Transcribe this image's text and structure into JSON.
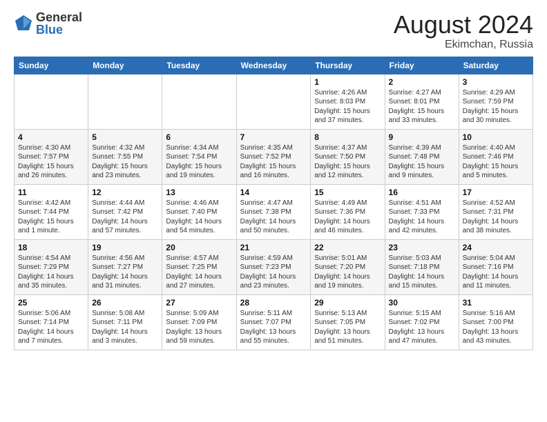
{
  "header": {
    "logo_general": "General",
    "logo_blue": "Blue",
    "month_title": "August 2024",
    "location": "Ekimchan, Russia"
  },
  "calendar": {
    "headers": [
      "Sunday",
      "Monday",
      "Tuesday",
      "Wednesday",
      "Thursday",
      "Friday",
      "Saturday"
    ],
    "weeks": [
      [
        {
          "day": "",
          "detail": ""
        },
        {
          "day": "",
          "detail": ""
        },
        {
          "day": "",
          "detail": ""
        },
        {
          "day": "",
          "detail": ""
        },
        {
          "day": "1",
          "detail": "Sunrise: 4:26 AM\nSunset: 8:03 PM\nDaylight: 15 hours\nand 37 minutes."
        },
        {
          "day": "2",
          "detail": "Sunrise: 4:27 AM\nSunset: 8:01 PM\nDaylight: 15 hours\nand 33 minutes."
        },
        {
          "day": "3",
          "detail": "Sunrise: 4:29 AM\nSunset: 7:59 PM\nDaylight: 15 hours\nand 30 minutes."
        }
      ],
      [
        {
          "day": "4",
          "detail": "Sunrise: 4:30 AM\nSunset: 7:57 PM\nDaylight: 15 hours\nand 26 minutes."
        },
        {
          "day": "5",
          "detail": "Sunrise: 4:32 AM\nSunset: 7:55 PM\nDaylight: 15 hours\nand 23 minutes."
        },
        {
          "day": "6",
          "detail": "Sunrise: 4:34 AM\nSunset: 7:54 PM\nDaylight: 15 hours\nand 19 minutes."
        },
        {
          "day": "7",
          "detail": "Sunrise: 4:35 AM\nSunset: 7:52 PM\nDaylight: 15 hours\nand 16 minutes."
        },
        {
          "day": "8",
          "detail": "Sunrise: 4:37 AM\nSunset: 7:50 PM\nDaylight: 15 hours\nand 12 minutes."
        },
        {
          "day": "9",
          "detail": "Sunrise: 4:39 AM\nSunset: 7:48 PM\nDaylight: 15 hours\nand 9 minutes."
        },
        {
          "day": "10",
          "detail": "Sunrise: 4:40 AM\nSunset: 7:46 PM\nDaylight: 15 hours\nand 5 minutes."
        }
      ],
      [
        {
          "day": "11",
          "detail": "Sunrise: 4:42 AM\nSunset: 7:44 PM\nDaylight: 15 hours\nand 1 minute."
        },
        {
          "day": "12",
          "detail": "Sunrise: 4:44 AM\nSunset: 7:42 PM\nDaylight: 14 hours\nand 57 minutes."
        },
        {
          "day": "13",
          "detail": "Sunrise: 4:46 AM\nSunset: 7:40 PM\nDaylight: 14 hours\nand 54 minutes."
        },
        {
          "day": "14",
          "detail": "Sunrise: 4:47 AM\nSunset: 7:38 PM\nDaylight: 14 hours\nand 50 minutes."
        },
        {
          "day": "15",
          "detail": "Sunrise: 4:49 AM\nSunset: 7:36 PM\nDaylight: 14 hours\nand 46 minutes."
        },
        {
          "day": "16",
          "detail": "Sunrise: 4:51 AM\nSunset: 7:33 PM\nDaylight: 14 hours\nand 42 minutes."
        },
        {
          "day": "17",
          "detail": "Sunrise: 4:52 AM\nSunset: 7:31 PM\nDaylight: 14 hours\nand 38 minutes."
        }
      ],
      [
        {
          "day": "18",
          "detail": "Sunrise: 4:54 AM\nSunset: 7:29 PM\nDaylight: 14 hours\nand 35 minutes."
        },
        {
          "day": "19",
          "detail": "Sunrise: 4:56 AM\nSunset: 7:27 PM\nDaylight: 14 hours\nand 31 minutes."
        },
        {
          "day": "20",
          "detail": "Sunrise: 4:57 AM\nSunset: 7:25 PM\nDaylight: 14 hours\nand 27 minutes."
        },
        {
          "day": "21",
          "detail": "Sunrise: 4:59 AM\nSunset: 7:23 PM\nDaylight: 14 hours\nand 23 minutes."
        },
        {
          "day": "22",
          "detail": "Sunrise: 5:01 AM\nSunset: 7:20 PM\nDaylight: 14 hours\nand 19 minutes."
        },
        {
          "day": "23",
          "detail": "Sunrise: 5:03 AM\nSunset: 7:18 PM\nDaylight: 14 hours\nand 15 minutes."
        },
        {
          "day": "24",
          "detail": "Sunrise: 5:04 AM\nSunset: 7:16 PM\nDaylight: 14 hours\nand 11 minutes."
        }
      ],
      [
        {
          "day": "25",
          "detail": "Sunrise: 5:06 AM\nSunset: 7:14 PM\nDaylight: 14 hours\nand 7 minutes."
        },
        {
          "day": "26",
          "detail": "Sunrise: 5:08 AM\nSunset: 7:11 PM\nDaylight: 14 hours\nand 3 minutes."
        },
        {
          "day": "27",
          "detail": "Sunrise: 5:09 AM\nSunset: 7:09 PM\nDaylight: 13 hours\nand 59 minutes."
        },
        {
          "day": "28",
          "detail": "Sunrise: 5:11 AM\nSunset: 7:07 PM\nDaylight: 13 hours\nand 55 minutes."
        },
        {
          "day": "29",
          "detail": "Sunrise: 5:13 AM\nSunset: 7:05 PM\nDaylight: 13 hours\nand 51 minutes."
        },
        {
          "day": "30",
          "detail": "Sunrise: 5:15 AM\nSunset: 7:02 PM\nDaylight: 13 hours\nand 47 minutes."
        },
        {
          "day": "31",
          "detail": "Sunrise: 5:16 AM\nSunset: 7:00 PM\nDaylight: 13 hours\nand 43 minutes."
        }
      ]
    ]
  }
}
